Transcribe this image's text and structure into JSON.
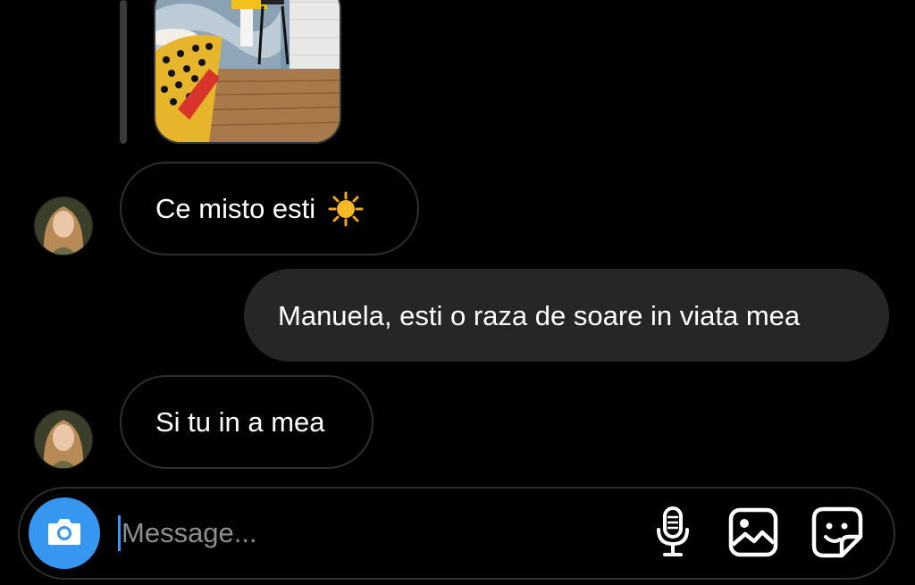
{
  "thread": {
    "messages": [
      {
        "sender": "them",
        "text": "Ce misto esti",
        "emoji": "sun"
      },
      {
        "sender": "me",
        "text": "Manuela, esti o raza de soare in viata mea"
      },
      {
        "sender": "them",
        "text": "Si tu in a mea"
      }
    ]
  },
  "composer": {
    "placeholder": "Message...",
    "icons": [
      "camera-icon",
      "microphone-icon",
      "gallery-icon",
      "sticker-icon"
    ]
  },
  "colors": {
    "background": "#000000",
    "incoming_border": "#2e2e2e",
    "outgoing_bubble": "#262626",
    "accent": "#3797f0"
  }
}
